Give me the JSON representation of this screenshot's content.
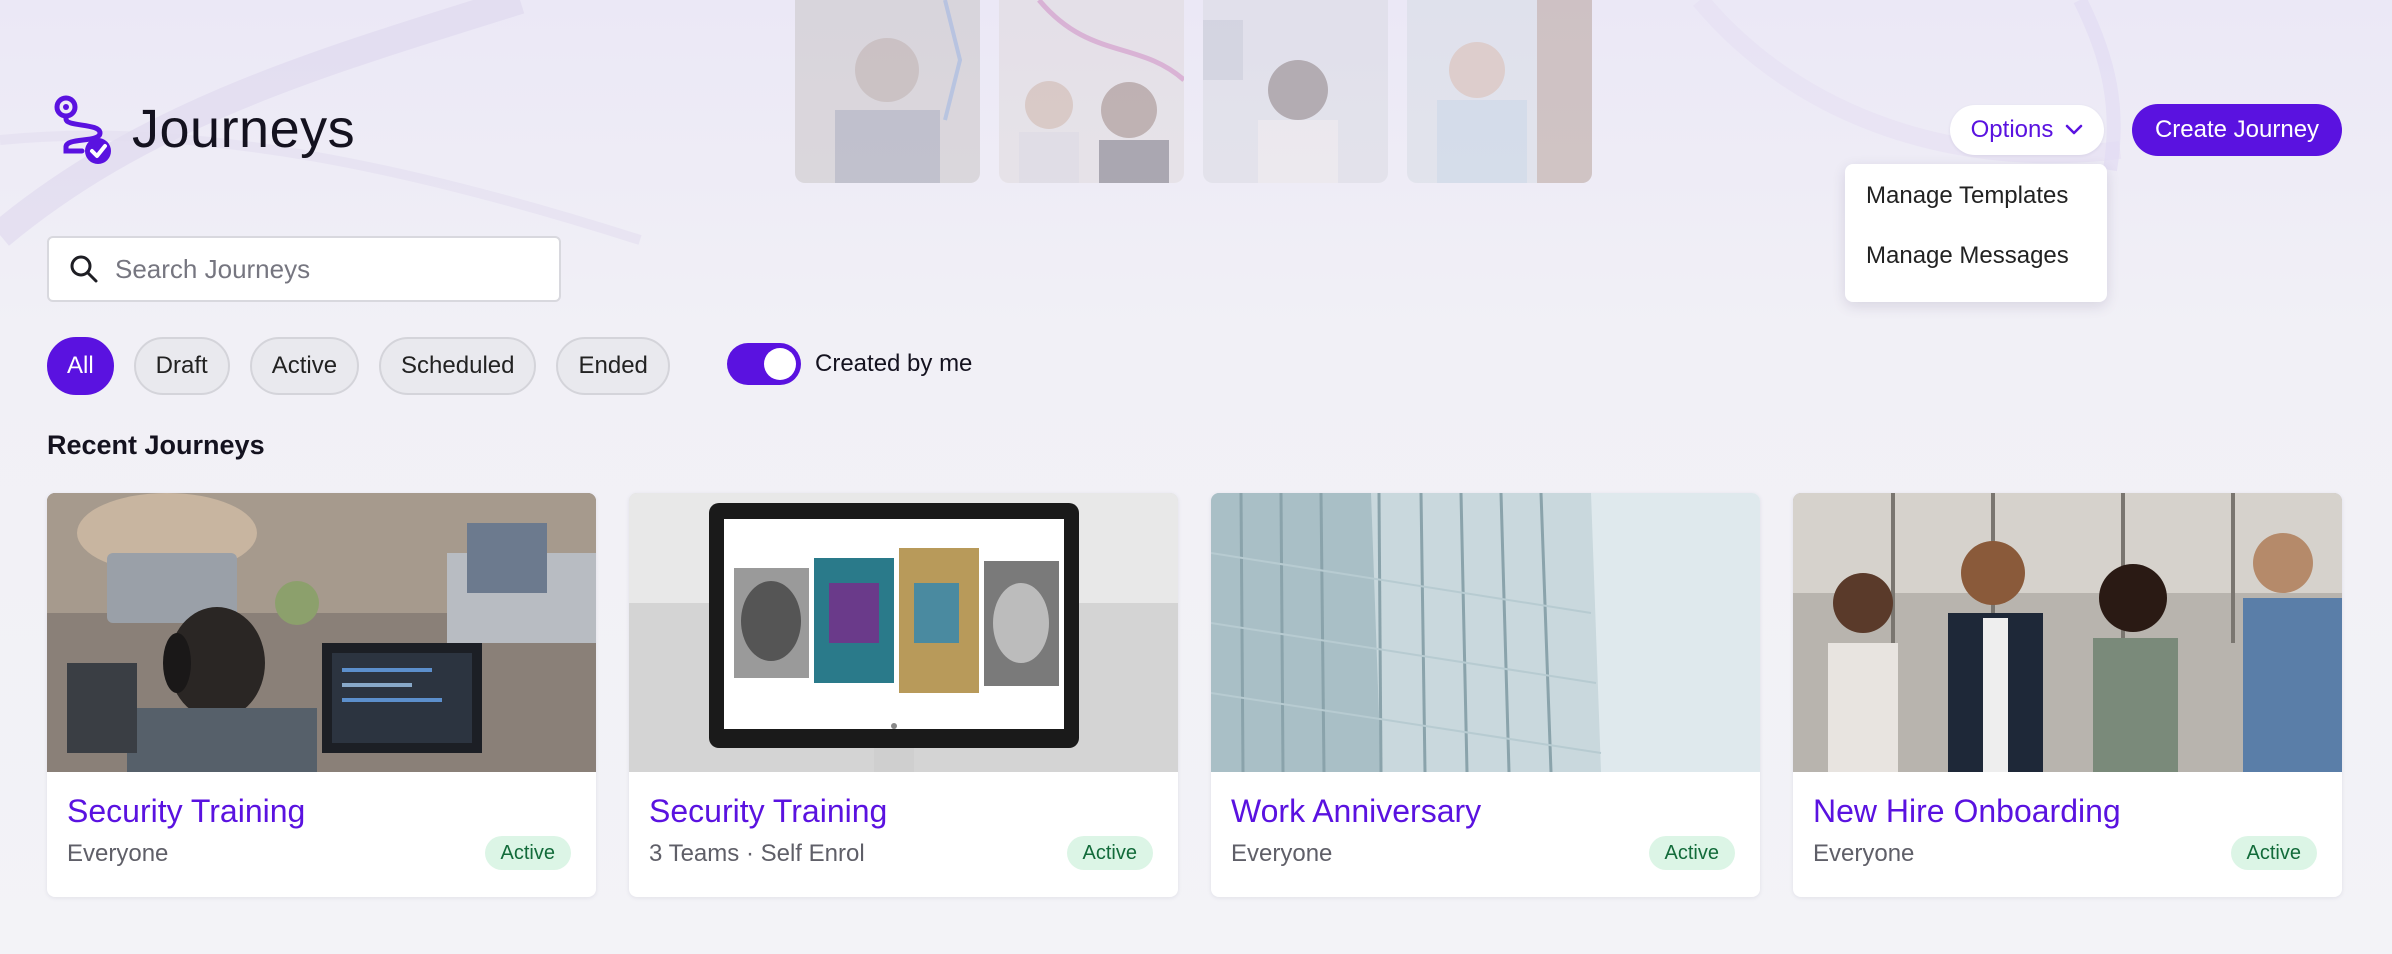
{
  "header": {
    "title": "Journeys",
    "options_label": "Options",
    "create_label": "Create Journey"
  },
  "options_menu": {
    "items": [
      {
        "label": "Manage Templates"
      },
      {
        "label": "Manage Messages"
      }
    ]
  },
  "search": {
    "placeholder": "Search Journeys",
    "value": ""
  },
  "filters": {
    "chips": [
      {
        "label": "All",
        "selected": true
      },
      {
        "label": "Draft",
        "selected": false
      },
      {
        "label": "Active",
        "selected": false
      },
      {
        "label": "Scheduled",
        "selected": false
      },
      {
        "label": "Ended",
        "selected": false
      }
    ],
    "toggle": {
      "label": "Created by me",
      "on": true
    }
  },
  "recent": {
    "heading": "Recent Journeys",
    "cards": [
      {
        "title": "Security Training",
        "audience": "Everyone",
        "status": "Active",
        "image": "people-coding-laptops-photo"
      },
      {
        "title": "Security Training",
        "audience": "3 Teams · Self Enrol",
        "status": "Active",
        "image": "monitor-gallery-photo"
      },
      {
        "title": "Work Anniversary",
        "audience": "Everyone",
        "status": "Active",
        "image": "glass-building-photo"
      },
      {
        "title": "New Hire Onboarding",
        "audience": "Everyone",
        "status": "Active",
        "image": "team-walking-office-photo"
      }
    ]
  },
  "colors": {
    "accent": "#5a12e0",
    "badge_bg": "#dcf5e6",
    "badge_text": "#126b3a",
    "page_bg": "#f3f3f7"
  },
  "icons": {
    "logo": "journeys-logo-icon",
    "search": "search-icon",
    "chevron": "chevron-down-icon"
  }
}
